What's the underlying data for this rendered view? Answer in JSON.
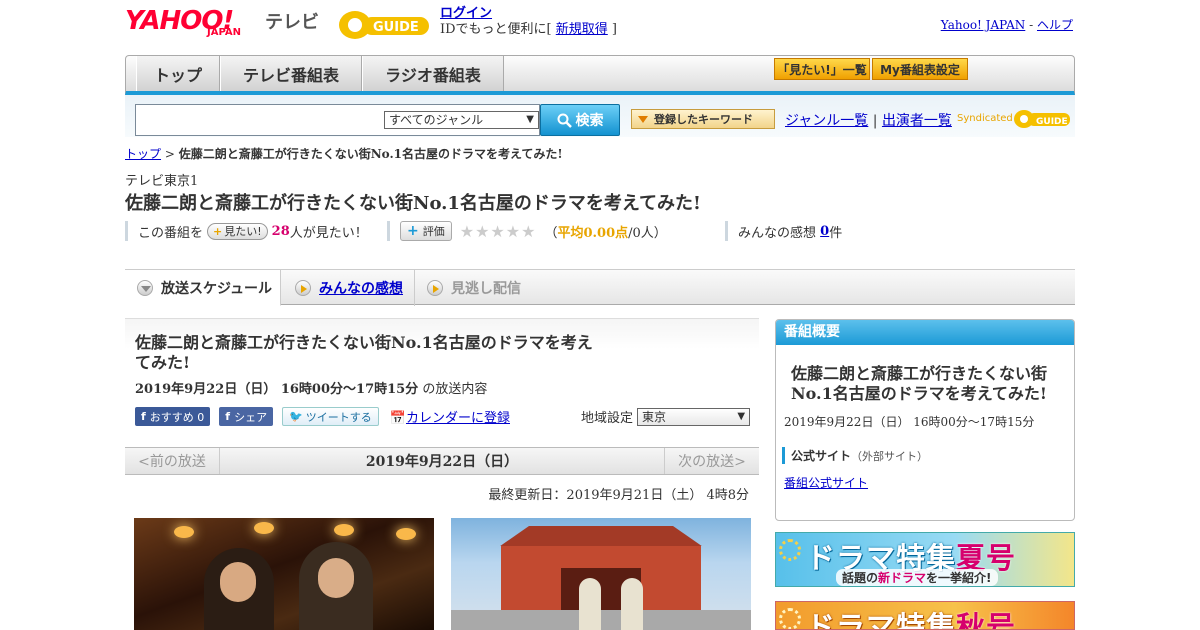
{
  "header": {
    "logo_yahoo": "YAHOO!",
    "logo_japan": "JAPAN",
    "logo_tv": "テレビ",
    "logo_gguide": "GUIDE",
    "login": "ログイン",
    "id_prefix": "IDでもっと便利に[ ",
    "signup": "新規取得",
    "id_suffix": " ]",
    "yahoo_japan": "Yahoo! JAPAN",
    "sep": " - ",
    "help": "ヘルプ"
  },
  "nav": {
    "tabs": [
      "トップ",
      "テレビ番組表",
      "ラジオ番組表"
    ],
    "btn_watchlist": "「見たい!」一覧",
    "btn_my_schedule": "My番組表設定"
  },
  "search": {
    "placeholder": "",
    "genre_selected": "すべてのジャンル",
    "button": "検索",
    "keyword_button": "登録したキーワード",
    "genre_list": "ジャンル一覧",
    "divider": "|",
    "cast_list": "出演者一覧",
    "syndicated": "Syndicated",
    "syndicated_logo": "GUIDE"
  },
  "breadcrumb": {
    "top": "トップ",
    "sep": " > ",
    "current": "佐藤二朗と斎藤工が行きたくない街No.1名古屋のドラマを考えてみた!"
  },
  "program": {
    "channel": "テレビ東京1",
    "title": "佐藤二朗と斎藤工が行きたくない街No.1名古屋のドラマを考えてみた!",
    "want_prefix": "この番組を",
    "want_button": "見たい!",
    "want_count": "28",
    "want_suffix": "人が見たい！",
    "rate_button": "評価",
    "stars": "★★★★★",
    "avg_open": "（",
    "avg_label": "平均0.00点",
    "avg_rest": "/0人）",
    "reviews_label": "みんなの感想",
    "reviews_count": "0",
    "reviews_unit": "件"
  },
  "subtabs": {
    "schedule": "放送スケジュール",
    "reviews": "みんなの感想",
    "vod": "見逃し配信"
  },
  "main": {
    "title": "佐藤二朗と斎藤工が行きたくない街No.1名古屋のドラマを考えてみた!",
    "datetime": "2019年9月22日（日） 16時00分～17時15分",
    "datetime_suffix": " の放送内容",
    "fb_recommend": "おすすめ 0",
    "fb_share": "シェア",
    "tweet": "ツイートする",
    "calendar": "カレンダーに登録",
    "region_label": "地域設定",
    "region_value": "東京",
    "prev": "<前の放送",
    "date": "2019年9月22日（日）",
    "next": "次の放送>",
    "updated": "最終更新日：2019年9月21日（土） 4時8分"
  },
  "side": {
    "header": "番組概要",
    "title": "佐藤二朗と斎藤工が行きたくない街No.1名古屋のドラマを考えてみた!",
    "time": "2019年9月22日（日） 16時00分～17時15分",
    "official_label": "公式サイト",
    "official_note": "（外部サイト）",
    "official_link": "番組公式サイト"
  },
  "banners": {
    "b1_title_a": "ドラマ特集",
    "b1_title_b": "夏号",
    "b1_sub_a": "話題の",
    "b1_sub_b": "新ドラマ",
    "b1_sub_c": "を一挙紹介!",
    "b2_title_a": "ドラマ特集",
    "b2_title_b": "秋号"
  },
  "colors": {
    "accent_blue": "#1c9ad6",
    "yahoo_red": "#ff0033",
    "pink": "#d6006d",
    "orange": "#e8a500"
  }
}
